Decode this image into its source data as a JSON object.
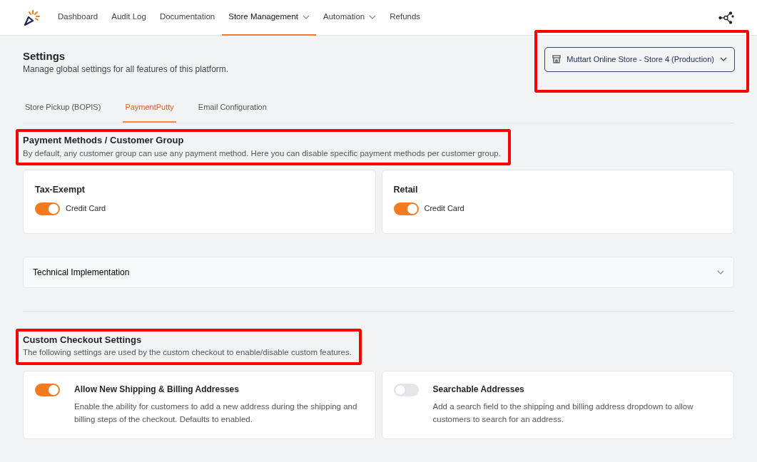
{
  "nav": {
    "items": [
      {
        "label": "Dashboard",
        "selected": false,
        "dropdown": false
      },
      {
        "label": "Audit Log",
        "selected": false,
        "dropdown": false
      },
      {
        "label": "Documentation",
        "selected": false,
        "dropdown": false
      },
      {
        "label": "Store Management",
        "selected": true,
        "dropdown": true
      },
      {
        "label": "Automation",
        "selected": false,
        "dropdown": true
      },
      {
        "label": "Refunds",
        "selected": false,
        "dropdown": false
      }
    ]
  },
  "page": {
    "title": "Settings",
    "subtitle": "Manage global settings for all features of this platform."
  },
  "store_selector": {
    "value": "Muttart Online Store - Store 4 (Production)",
    "highlighted": true
  },
  "tabs": [
    {
      "label": "Store Pickup (BOPIS)",
      "selected": false
    },
    {
      "label": "PaymentPutty",
      "selected": true
    },
    {
      "label": "Email Configuration",
      "selected": false
    }
  ],
  "payment_section": {
    "title": "Payment Methods / Customer Group",
    "description": "By default, any customer group can use any payment method. Here you can disable specific payment methods per customer group.",
    "highlighted": true,
    "groups": [
      {
        "name": "Tax-Exempt",
        "methods": [
          {
            "label": "Credit Card",
            "on": true
          }
        ]
      },
      {
        "name": "Retail",
        "methods": [
          {
            "label": "Credit Card",
            "on": true
          }
        ]
      }
    ]
  },
  "accordion": {
    "title": "Technical Implementation",
    "expanded": false
  },
  "checkout_section": {
    "title": "Custom Checkout Settings",
    "description": "The following settings are used by the custom checkout to enable/disable custom features.",
    "highlighted": true,
    "settings": [
      {
        "title": "Allow New Shipping & Billing Addresses",
        "description": "Enable the ability for customers to add a new address during the shipping and billing steps of the checkout. Defaults to enabled.",
        "on": true
      },
      {
        "title": "Searchable Addresses",
        "description": "Add a search field to the shipping and billing address dropdown to allow customers to search for an address.",
        "on": false
      }
    ]
  }
}
